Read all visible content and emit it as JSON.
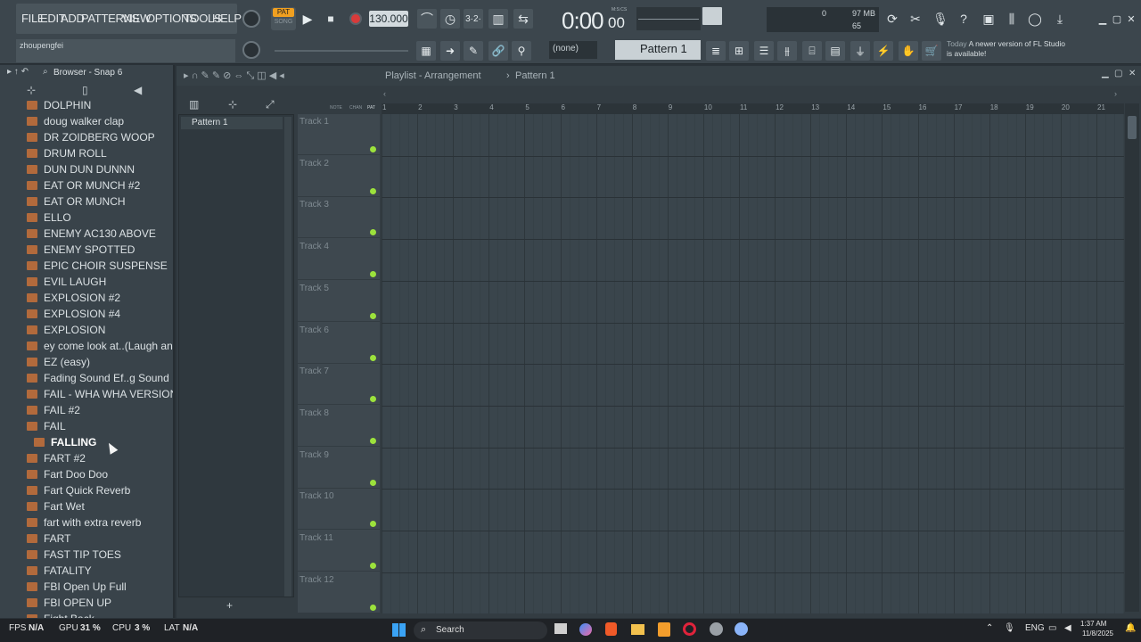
{
  "menu": [
    "FILE",
    "EDIT",
    "ADD",
    "PATTERNS",
    "VIEW",
    "OPTIONS",
    "TOOLS",
    "HELP"
  ],
  "transport": {
    "pat_label": "PAT",
    "song_label": "SONG",
    "tempo": "130.000",
    "time": "0:00",
    "time_sub": "00",
    "time_caption": "M:S:CS"
  },
  "cpu_mem": {
    "top": "0",
    "mem": "97 MB",
    "bottom": "65"
  },
  "hint_user": "zhoupengfei",
  "toolbar2": {
    "none_label": "(none)",
    "pattern": "Pattern 1",
    "news_date": "Today",
    "news_text": "A newer version of FL Studio is available!"
  },
  "browser": {
    "title": "Browser - Snap 6",
    "items": [
      "DOLPHIN",
      "doug walker clap",
      "DR ZOIDBERG WOOP",
      "DRUM ROLL",
      "DUN DUN DUNNN",
      "EAT OR MUNCH #2",
      "EAT OR MUNCH",
      "ELLO",
      "ENEMY AC130 ABOVE",
      "ENEMY SPOTTED",
      "EPIC CHOIR SUSPENSE",
      "EVIL LAUGH",
      "EXPLOSION #2",
      "EXPLOSION #4",
      "EXPLOSION",
      "ey come look at..(Laugh and run)",
      "EZ (easy)",
      "Fading Sound Ef..g Sound Effect)",
      "FAIL - WHA WHA VERSION",
      "FAIL #2",
      "FAIL",
      "FALLING",
      "FART #2",
      "Fart Doo Doo",
      "Fart Quick Reverb",
      "Fart Wet",
      "fart with extra reverb",
      "FART",
      "FAST TIP TOES",
      "FATALITY",
      "FBI Open Up Full",
      "FBI OPEN UP",
      "Fight Back"
    ],
    "selected": "FALLING"
  },
  "playlist": {
    "title": "Playlist - Arrangement",
    "crumb": "Pattern 1",
    "pattern_item": "Pattern 1",
    "header_small": [
      "NOTE",
      "CHAN",
      "PAT"
    ],
    "tracks": [
      "Track 1",
      "Track 2",
      "Track 3",
      "Track 4",
      "Track 5",
      "Track 6",
      "Track 7",
      "Track 8",
      "Track 9",
      "Track 10",
      "Track 11",
      "Track 12"
    ],
    "bars": [
      "1",
      "2",
      "3",
      "4",
      "5",
      "6",
      "7",
      "8",
      "9",
      "10",
      "11",
      "12",
      "13",
      "14",
      "15",
      "16",
      "17",
      "18",
      "19",
      "20",
      "21"
    ]
  },
  "taskbar": {
    "fps": "FPS",
    "fps_val": "N/A",
    "gpu": "GPU",
    "gpu_val": "31 %",
    "cpu": "CPU",
    "cpu_val": "3 %",
    "lat": "LAT",
    "lat_val": "N/A",
    "search": "Search",
    "lang": "ENG",
    "time": "1:37 AM",
    "date": "11/8/2025"
  }
}
